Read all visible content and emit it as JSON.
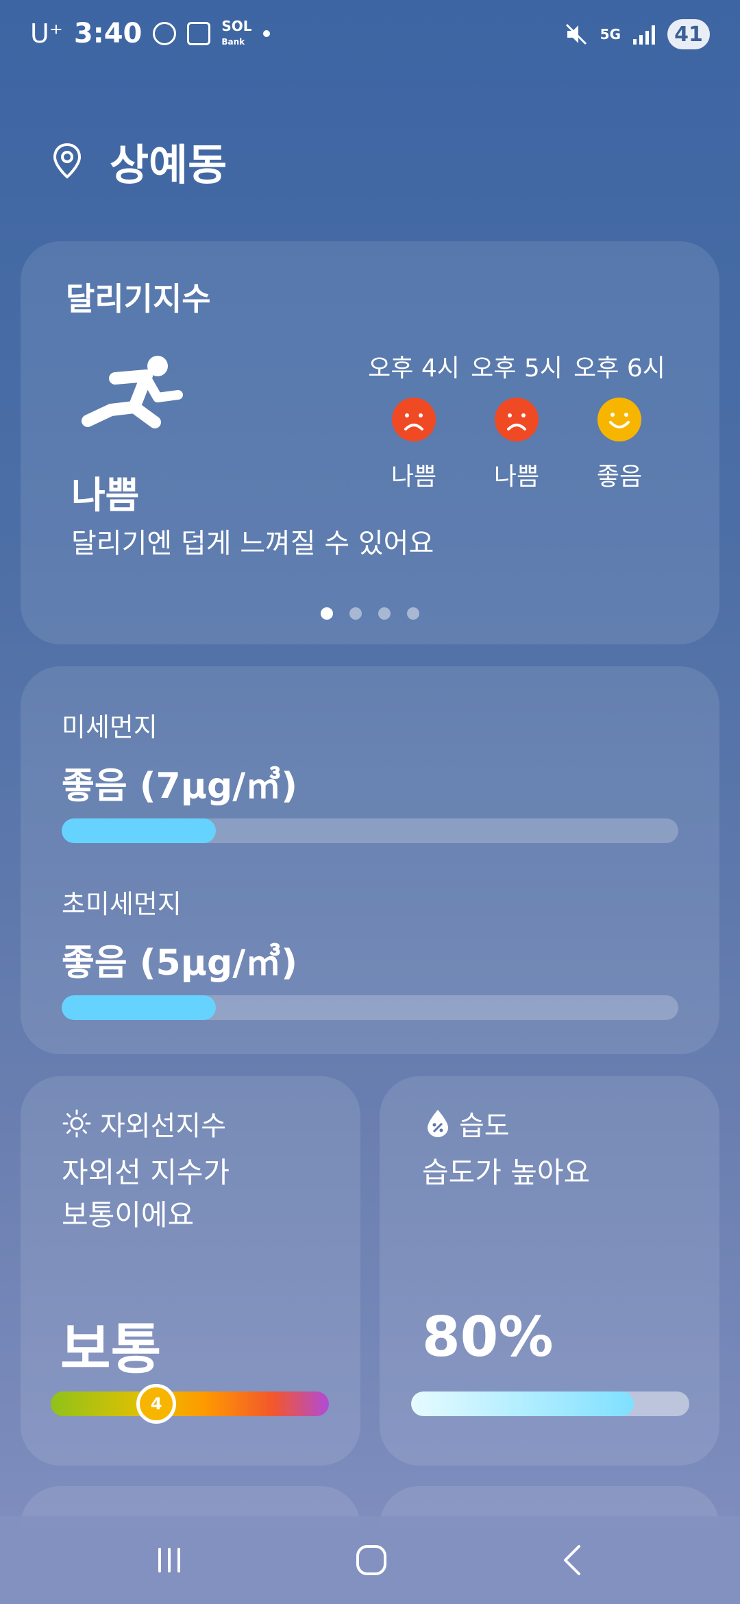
{
  "status_bar": {
    "carrier": "U⁺",
    "time": "3:40",
    "network": "5G",
    "battery": "41"
  },
  "location": {
    "name": "상예동"
  },
  "running": {
    "title": "달리기지수",
    "status": "나쁨",
    "description": "달리기엔 덥게 느껴질 수 있어요",
    "forecast": [
      {
        "time": "오후 4시",
        "label": "나쁨",
        "mood": "bad"
      },
      {
        "time": "오후 5시",
        "label": "나쁨",
        "mood": "bad"
      },
      {
        "time": "오후 6시",
        "label": "좋음",
        "mood": "good"
      }
    ],
    "page_indicator": {
      "count": 4,
      "active": 0
    }
  },
  "air": {
    "pm10": {
      "label": "미세먼지",
      "value": "좋음 (7µg/㎥)",
      "level": 0.25
    },
    "pm25": {
      "label": "초미세먼지",
      "value": "좋음 (5µg/㎥)",
      "level": 0.25
    }
  },
  "uv": {
    "title": "자외선지수",
    "description": "자외선 지수가\n보통이에요",
    "value": "보통",
    "index": "4",
    "level": 0.38
  },
  "humidity": {
    "title": "습도",
    "description": "습도가 높아요",
    "value": "80%",
    "level": 0.8
  },
  "colors": {
    "bad_face": "#f04a25",
    "good_face": "#f7b500",
    "dust_fill": "#66d3ff"
  }
}
